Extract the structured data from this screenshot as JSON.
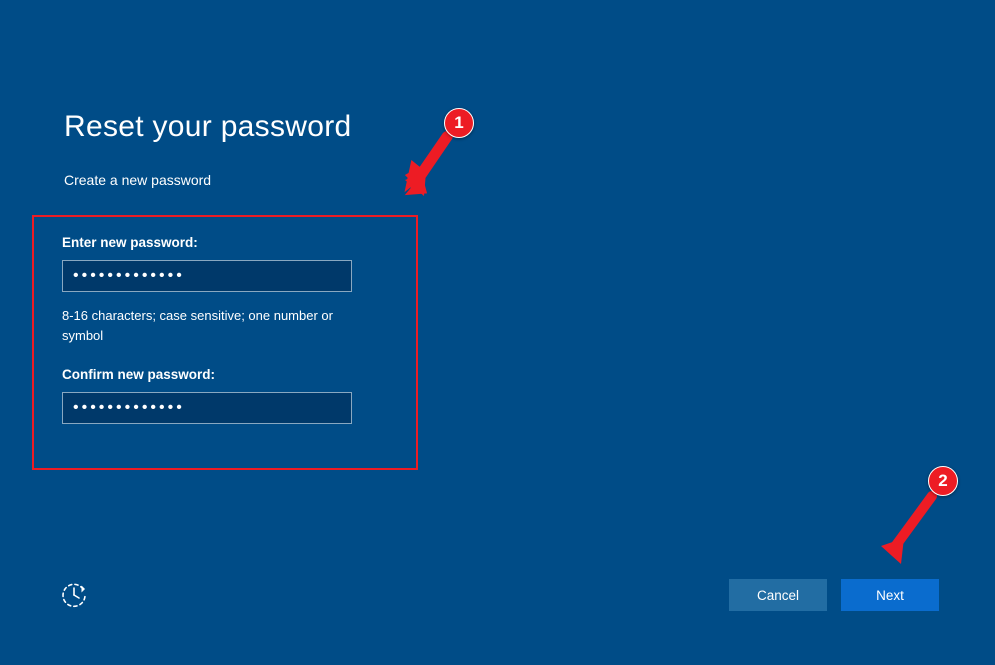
{
  "title": "Reset your password",
  "subtitle": "Create a new password",
  "form": {
    "enter_label": "Enter new password:",
    "enter_value": "•••••••••••••",
    "hint": "8-16 characters; case sensitive; one number or symbol",
    "confirm_label": "Confirm new password:",
    "confirm_value": "•••••••••••••"
  },
  "buttons": {
    "cancel": "Cancel",
    "next": "Next"
  },
  "annotations": {
    "callout1": "1",
    "callout2": "2"
  }
}
